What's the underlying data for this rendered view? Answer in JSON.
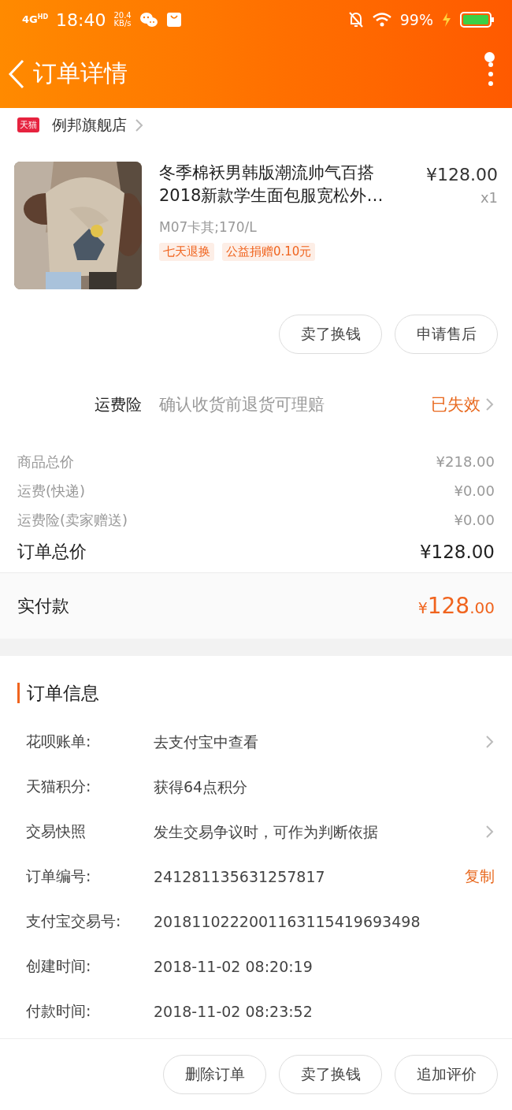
{
  "status_bar": {
    "network": "4G",
    "network_sup": "HD",
    "time": "18:40",
    "speed": "20.4",
    "speed_unit": "KB/s",
    "battery": "99%"
  },
  "nav": {
    "title": "订单详情",
    "menu_badge": true
  },
  "store": {
    "badge": "天猫",
    "name": "例邦旗舰店"
  },
  "product": {
    "title": "冬季棉袄男韩版潮流帅气百搭2018新款学生面包服宽松外…",
    "price": "¥128.00",
    "quantity": "x1",
    "sku": "M07卡其;170/L",
    "tags": [
      "七天退换",
      "公益捐赠0.10元"
    ]
  },
  "product_buttons": [
    "卖了换钱",
    "申请售后"
  ],
  "insurance": {
    "label": "运费险",
    "description": "确认收货前退货可理赔",
    "status": "已失效"
  },
  "costs": [
    {
      "label": "商品总价",
      "value": "¥218.00"
    },
    {
      "label": "运费(快递)",
      "value": "¥0.00"
    },
    {
      "label": "运费险(卖家赠送)",
      "value": "¥0.00"
    }
  ],
  "order_total": {
    "label": "订单总价",
    "value": "¥128.00"
  },
  "paid": {
    "label": "实付款",
    "currency": "¥",
    "integer": "128",
    "decimal": ".00"
  },
  "order_info": {
    "title": "订单信息",
    "rows": [
      {
        "label": "花呗账单:",
        "value": "去支付宝中查看",
        "kind": "link"
      },
      {
        "label": "天猫积分:",
        "value": "获得64点积分",
        "kind": "plain"
      },
      {
        "label": "交易快照",
        "value": "发生交易争议时，可作为判断依据",
        "kind": "link"
      },
      {
        "label": "订单编号:",
        "value": "241281135631257817",
        "kind": "copy",
        "action": "复制"
      },
      {
        "label": "支付宝交易号:",
        "value": "2018110222001163115419693498",
        "kind": "plain"
      },
      {
        "label": "创建时间:",
        "value": "2018-11-02 08:20:19",
        "kind": "plain"
      },
      {
        "label": "付款时间:",
        "value": "2018-11-02 08:23:52",
        "kind": "plain"
      }
    ]
  },
  "bottom_buttons": [
    "删除订单",
    "卖了换钱",
    "追加评价"
  ]
}
